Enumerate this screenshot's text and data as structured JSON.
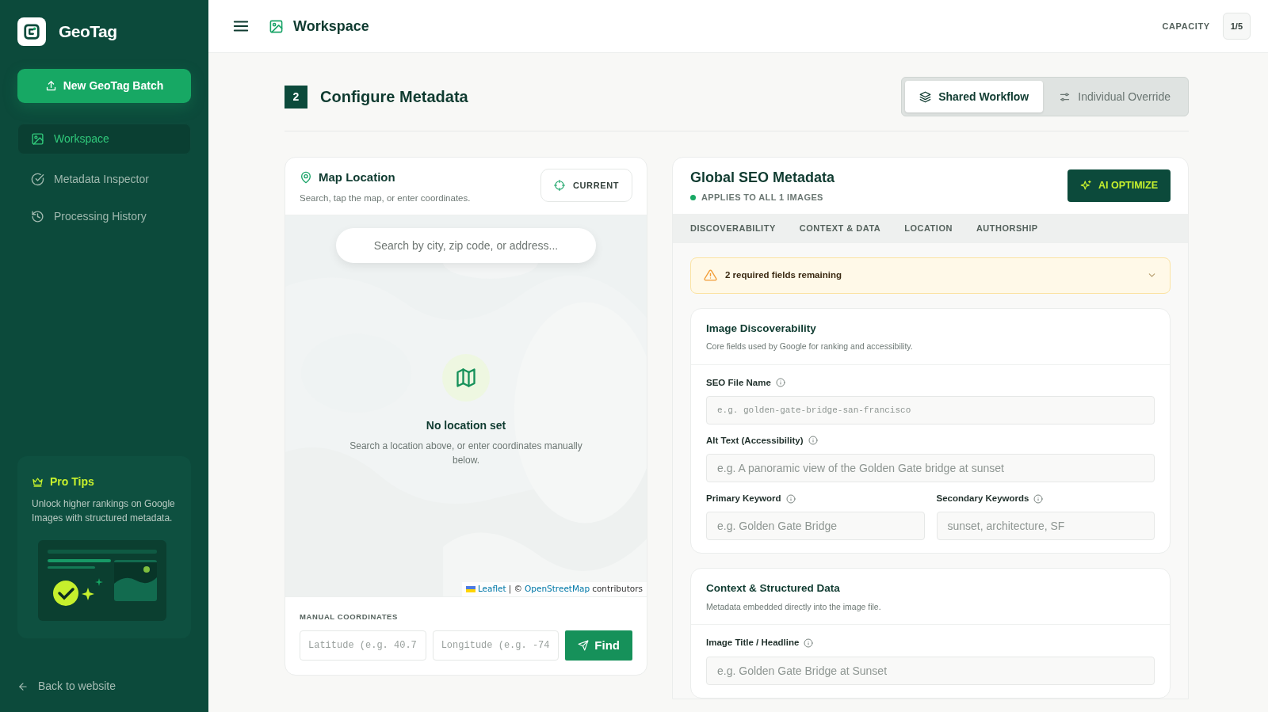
{
  "app": {
    "name": "GeoTag"
  },
  "sidebar": {
    "new_button": "New GeoTag Batch",
    "items": [
      {
        "label": "Workspace",
        "selected": true
      },
      {
        "label": "Metadata Inspector",
        "selected": false
      },
      {
        "label": "Processing History",
        "selected": false
      }
    ],
    "pro_tips": {
      "title": "Pro Tips",
      "text": "Unlock higher rankings on Google Images with structured metadata."
    },
    "back_link": "Back to website"
  },
  "header": {
    "title": "Workspace",
    "capacity_label": "CAPACITY",
    "capacity_value": "1/5"
  },
  "step": {
    "number": "2",
    "title": "Configure Metadata"
  },
  "modes": [
    {
      "label": "Shared Workflow",
      "selected": true
    },
    {
      "label": "Individual Override",
      "selected": false
    }
  ],
  "map_panel": {
    "title": "Map Location",
    "subtitle": "Search, tap the map, or enter coordinates.",
    "current_button": "CURRENT",
    "search": {
      "placeholder": "Search by city, zip code, or address..."
    },
    "empty_title": "No location set",
    "empty_text": "Search a location above, or enter coordinates manually below.",
    "attribution": {
      "leaflet": "Leaflet",
      "separator": "| ©",
      "osm": "OpenStreetMap",
      "suffix": "contributors"
    },
    "manual_label": "MANUAL COORDINATES",
    "latitude": {
      "placeholder": "Latitude (e.g. 40.7"
    },
    "longitude": {
      "placeholder": "Longitude (e.g. -74"
    },
    "find_button": "Find"
  },
  "seo_panel": {
    "title": "Global SEO Metadata",
    "applies": "APPLIES TO ALL 1 IMAGES",
    "ai_button": "AI OPTIMIZE",
    "tabs": [
      "DISCOVERABILITY",
      "CONTEXT & DATA",
      "LOCATION",
      "AUTHORSHIP"
    ],
    "alert": "2 required fields remaining",
    "sections": [
      {
        "title": "Image Discoverability",
        "subtitle": "Core fields used by Google for ranking and accessibility.",
        "rows": [
          [
            {
              "label": "SEO File Name",
              "placeholder": "e.g. golden-gate-bridge-san-francisco",
              "kind": "code"
            }
          ],
          [
            {
              "label": "Alt Text (Accessibility)",
              "placeholder": "e.g. A panoramic view of the Golden Gate bridge at sunset",
              "kind": "text"
            }
          ],
          [
            {
              "label": "Primary Keyword",
              "placeholder": "e.g. Golden Gate Bridge",
              "kind": "text"
            },
            {
              "label": "Secondary Keywords",
              "placeholder": "sunset, architecture, SF",
              "kind": "text"
            }
          ]
        ]
      },
      {
        "title": "Context & Structured Data",
        "subtitle": "Metadata embedded directly into the image file.",
        "rows": [
          [
            {
              "label": "Image Title / Headline",
              "placeholder": "e.g. Golden Gate Bridge at Sunset",
              "kind": "text"
            }
          ]
        ]
      }
    ]
  }
}
